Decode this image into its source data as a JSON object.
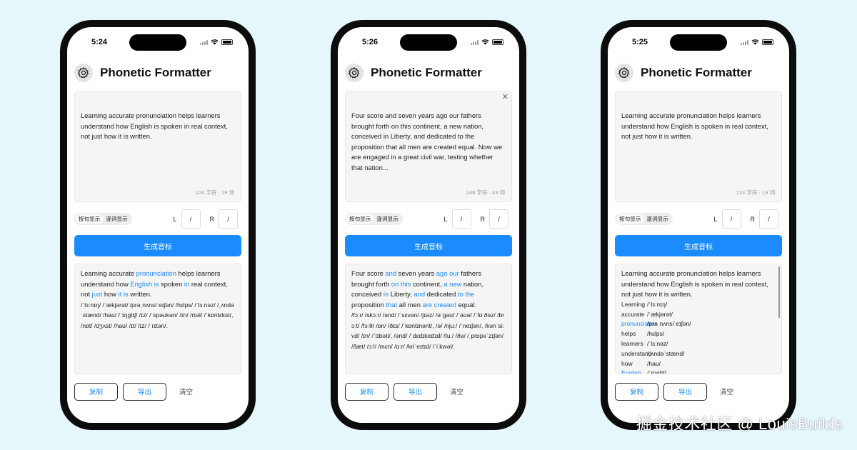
{
  "app": {
    "title": "Phonetic Formatter",
    "mode_sentence": "按句显示",
    "mode_word": "逐词显示",
    "l_label": "L",
    "r_label": "R",
    "l_value": "/",
    "r_value": "/",
    "generate": "生成音标",
    "copy": "复制",
    "export": "导出",
    "clear": "清空"
  },
  "colors": {
    "accent": "#1a8cff",
    "background": "#e6f7fb"
  },
  "icons": {
    "settings": "gear-icon",
    "clear_input": "close-icon",
    "signal": "signal-icon",
    "wifi": "wifi-icon",
    "battery": "battery-icon"
  },
  "phones": [
    {
      "time": "5:24",
      "input": "Learning accurate pronunciation helps learners understand how English is spoken in real context, not just how it is written.",
      "count": "124 字符 · 19 词",
      "show_clear": false,
      "output_text": [
        {
          "t": "Learning accurate "
        },
        {
          "t": "pronunciation",
          "hl": true
        },
        {
          "t": " helps learners understand how "
        },
        {
          "t": "English",
          "hl": true
        },
        {
          "t": " "
        },
        {
          "t": "is",
          "hl": true
        },
        {
          "t": " spoken "
        },
        {
          "t": "in",
          "hl": true
        },
        {
          "t": " real context, not "
        },
        {
          "t": "just",
          "hl": true
        },
        {
          "t": " how "
        },
        {
          "t": "it",
          "hl": true
        },
        {
          "t": " "
        },
        {
          "t": "is",
          "hl": true
        },
        {
          "t": " written."
        }
      ],
      "ipa": "/ˈlɜːnɪŋ/ /ˈækjərət/ /prəˌnʌnsiˈeɪʃən/ /hɛlps/ /ˈlɜːnəz/ /ˌʌndəˈstænd/ /haʊ/ /ˈɪŋglɪʃ/ /ɪz/ /ˈspəʊkən/ /ɪn/ /rɪəl/ /ˈkɒntɛkst/, /nɒt/ /dʒʌst/ /haʊ/ /ɪt/ /ɪz/ /ˈrɪtən/.",
      "words": []
    },
    {
      "time": "5:26",
      "input": "Four score and seven years ago our fathers brought forth on this continent, a new nation, conceived in Liberty, and dedicated to the proposition that all men are created equal. Now we are engaged in a great civil war, testing whether that nation...",
      "count": "248 字符 · 43 词",
      "show_clear": true,
      "output_text": [
        {
          "t": "Four score "
        },
        {
          "t": "and",
          "hl": true
        },
        {
          "t": " seven years "
        },
        {
          "t": "ago",
          "hl": true
        },
        {
          "t": " "
        },
        {
          "t": "our",
          "hl": true
        },
        {
          "t": " fathers brought forth "
        },
        {
          "t": "on this",
          "hl": true
        },
        {
          "t": " continent, "
        },
        {
          "t": "a new",
          "hl": true
        },
        {
          "t": " nation, conceived "
        },
        {
          "t": "in",
          "hl": true
        },
        {
          "t": " Liberty, "
        },
        {
          "t": "and",
          "hl": true
        },
        {
          "t": " dedicated "
        },
        {
          "t": "to the",
          "hl": true
        },
        {
          "t": " proposition "
        },
        {
          "t": "that",
          "hl": true
        },
        {
          "t": " all men "
        },
        {
          "t": "are created",
          "hl": true
        },
        {
          "t": " equal."
        }
      ],
      "ipa": "/fɔːr/ /skɔːr/ /ənd/ /ˈsɛvən/ /jɪəz/ /əˈgəʊ/ /ˈaʊə/ /ˈfɑːðəz/ /brɔːt/ /fɔːθ/ /ɒn/ /ðɪs/ /ˈkɒntɪnənt/, /ə/ /njuː/ /ˈneɪʃən/, /kənˈsiːvd/ /ɪn/ /ˈlɪbəti/, /ənd/ /ˈdɛdɪkeɪtɪd/ /tuː/ /ðə/ /ˌprɒpəˈzɪʃən/ /ðæt/ /ɔːl/ /mɛn/ /ɑːr/ /kriˈeɪtɪd/ /ˈiːkwəl/.",
      "words": []
    },
    {
      "time": "5:25",
      "input": "Learning accurate pronunciation helps learners understand how English is spoken in real context, not just how it is written.",
      "count": "124 字符 · 19 词",
      "show_clear": false,
      "output_text": [
        {
          "t": "Learning accurate pronunciation helps learners understand how English is spoken in real context, not just how it is written."
        }
      ],
      "ipa": "",
      "words": [
        {
          "w": "Learning",
          "p": "/ˈlɜːnɪŋ/",
          "hl": false
        },
        {
          "w": "accurate",
          "p": "/ˈækjərət/",
          "hl": false
        },
        {
          "w": "pronunciation",
          "p": "/prəˌnʌnsiˈeɪʃən/",
          "hl": true
        },
        {
          "w": "helps",
          "p": "/hɛlps/",
          "hl": false
        },
        {
          "w": "learners",
          "p": "/ˈlɜːnəz/",
          "hl": false
        },
        {
          "w": "understand",
          "p": "/ˌʌndəˈstænd/",
          "hl": false
        },
        {
          "w": "how",
          "p": "/haʊ/",
          "hl": false
        },
        {
          "w": "English",
          "p": "/ˈɪŋglɪʃ/",
          "hl": true
        }
      ]
    }
  ],
  "watermark": "掘金技术社区 @ LouisBuilds"
}
